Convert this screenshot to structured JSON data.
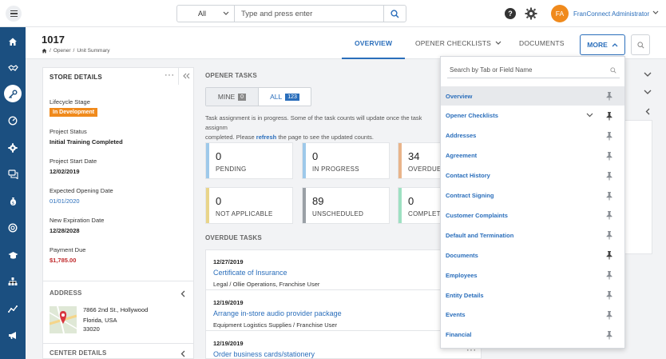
{
  "header": {
    "search_category": "All",
    "search_placeholder": "Type and press enter",
    "avatar_initials": "FA",
    "user_name": "FranConnect Administrator"
  },
  "page": {
    "title": "1017",
    "breadcrumb": [
      "Opener",
      "Unit Summary"
    ],
    "tabs": [
      "OVERVIEW",
      "OPENER CHECKLISTS",
      "DOCUMENTS"
    ],
    "active_tab": "OVERVIEW",
    "more_label": "MORE"
  },
  "store_details": {
    "title": "STORE DETAILS",
    "lifecycle_label": "Lifecycle Stage",
    "lifecycle_value": "In Development",
    "project_status_label": "Project Status",
    "project_status_value": "Initial Training Completed",
    "project_start_label": "Project Start Date",
    "project_start_value": "12/02/2019",
    "expected_opening_label": "Expected Opening Date",
    "expected_opening_value": "01/01/2020",
    "new_expiration_label": "New Expiration Date",
    "new_expiration_value": "12/28/2028",
    "payment_due_label": "Payment Due",
    "payment_due_value": "$1,785.00",
    "address_title": "ADDRESS",
    "address_line1": "7866 2nd St., Hollywood",
    "address_line2": "Florida, USA",
    "address_line3": "33020",
    "center_details_title": "CENTER DETAILS"
  },
  "opener_tasks": {
    "title": "OPENER TASKS",
    "mine_label": "MINE",
    "mine_count": "0",
    "all_label": "ALL",
    "all_count": "123",
    "info_prefix": "Task assignment is in progress. Some of the task counts will update once the task assignm",
    "info_mid": "completed. Please ",
    "info_link": "refresh",
    "info_suffix": " the page to see the updated counts.",
    "stats": [
      {
        "count": "0",
        "label": "PENDING",
        "color": "#9ec9ea"
      },
      {
        "count": "0",
        "label": "IN PROGRESS",
        "color": "#9ec9ea"
      },
      {
        "count": "34",
        "label": "OVERDUE",
        "color": "#e9b48a"
      },
      {
        "count": "0",
        "label": "NOT APPLICABLE",
        "color": "#e9d58a"
      },
      {
        "count": "89",
        "label": "UNSCHEDULED",
        "color": "#9aa0a6"
      },
      {
        "count": "0",
        "label": "COMPLETED",
        "color": "#9ee0c2"
      }
    ]
  },
  "overdue_tasks": {
    "title": "OVERDUE TASKS",
    "rows": [
      {
        "date": "12/27/2019",
        "title": "Certificate of Insurance",
        "sub": "Legal / Ollie Operations, Franchise User"
      },
      {
        "date": "12/19/2019",
        "title": "Arrange in-store audio provider package",
        "sub": "Equipment Logistics Supplies / Franchise User"
      },
      {
        "date": "12/19/2019",
        "title": "Order business cards/stationery",
        "sub": ""
      }
    ]
  },
  "more_menu": {
    "search_placeholder": "Search by Tab or Field Name",
    "items": [
      {
        "label": "Overview",
        "highlighted": true,
        "pinned": false,
        "has_children": false
      },
      {
        "label": "Opener Checklists",
        "highlighted": false,
        "pinned": true,
        "has_children": true
      },
      {
        "label": "Addresses",
        "highlighted": false,
        "pinned": false,
        "has_children": false
      },
      {
        "label": "Agreement",
        "highlighted": false,
        "pinned": false,
        "has_children": false
      },
      {
        "label": "Contact History",
        "highlighted": false,
        "pinned": false,
        "has_children": false
      },
      {
        "label": "Contract Signing",
        "highlighted": false,
        "pinned": false,
        "has_children": false
      },
      {
        "label": "Customer Complaints",
        "highlighted": false,
        "pinned": false,
        "has_children": false
      },
      {
        "label": "Default and Termination",
        "highlighted": false,
        "pinned": false,
        "has_children": false
      },
      {
        "label": "Documents",
        "highlighted": false,
        "pinned": true,
        "has_children": false
      },
      {
        "label": "Employees",
        "highlighted": false,
        "pinned": false,
        "has_children": false
      },
      {
        "label": "Entity Details",
        "highlighted": false,
        "pinned": false,
        "has_children": false
      },
      {
        "label": "Events",
        "highlighted": false,
        "pinned": false,
        "has_children": false
      },
      {
        "label": "Financial",
        "highlighted": false,
        "pinned": false,
        "has_children": false
      }
    ]
  },
  "rail_icons": [
    "home-icon",
    "handshake-icon",
    "key-icon",
    "speedometer-icon",
    "settings-icon",
    "chat-icon",
    "money-bag-icon",
    "support-icon",
    "graduation-cap-icon",
    "org-chart-icon",
    "trend-icon",
    "megaphone-icon"
  ],
  "colors": {
    "brand": "#1b4f80",
    "accent": "#2a6ebb",
    "orange": "#f08a1c",
    "red": "#c0292b"
  }
}
